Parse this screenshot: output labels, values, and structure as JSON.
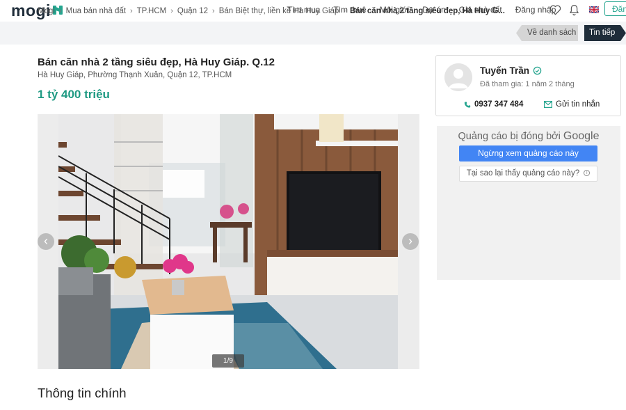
{
  "header": {
    "logo_text": "mogi",
    "nav": [
      "Tìm mua",
      "Tìm thuê",
      "Môi giới",
      "Dự án",
      "Giá nhà đất",
      "Đăng nhập"
    ],
    "login_button": "Đăn",
    "icons": [
      "heart-icon",
      "bell-icon",
      "uk-flag-icon"
    ]
  },
  "breadcrumb": {
    "items": [
      "Mogi",
      "Mua bán nhà đất",
      "TP.HCM",
      "Quận 12",
      "Bán Biệt thự, liền kề Hà Huy Giáp"
    ],
    "current": "Bán căn nhà 2 tầng siêu đẹp, Hà Huy G...",
    "back_label": "Về danh sách",
    "next_label": "Tin tiếp"
  },
  "listing": {
    "title": "Bán căn nhà 2 tầng siêu đẹp, Hà Huy Giáp. Q.12",
    "address": "Hà Huy Giáp, Phường Thạnh Xuân, Quận 12, TP.HCM",
    "price": "1 tỷ 400 triệu",
    "photo_counter": "1/9",
    "section_heading": "Thông tin chính"
  },
  "agent": {
    "name": "Tuyến Trần",
    "joined": "Đã tham gia: 1 năm 2 tháng",
    "phone": "0937 347 484",
    "message_label": "Gửi tin nhắn"
  },
  "ad": {
    "closed_by": "Quảng cáo bị đóng bởi",
    "google": "Google",
    "stop_label": "Ngừng xem quảng cáo này",
    "why_label": "Tại sao lại thấy quảng cáo này?"
  },
  "colors": {
    "brand": "#25a58f",
    "price": "#1f9a83",
    "dark": "#1f2d3a",
    "google_blue": "#4285f4"
  }
}
